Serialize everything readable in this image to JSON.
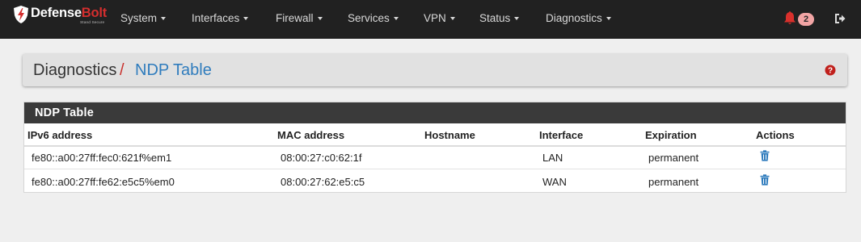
{
  "brand": {
    "name_part1": "Defense",
    "name_part2": "Bolt",
    "tagline": "Stand Secure"
  },
  "nav": {
    "items": [
      {
        "label": "System"
      },
      {
        "label": "Interfaces"
      },
      {
        "label": "Firewall"
      },
      {
        "label": "Services"
      },
      {
        "label": "VPN"
      },
      {
        "label": "Status"
      },
      {
        "label": "Diagnostics"
      }
    ],
    "notification_count": "2",
    "notification_icon": "bell-icon",
    "logout_icon": "sign-out-icon"
  },
  "breadcrumb": {
    "section": "Diagnostics",
    "separator": "/",
    "current": "NDP Table",
    "help_icon": "question-circle-icon"
  },
  "table": {
    "title": "NDP Table",
    "columns": [
      "IPv6 address",
      "MAC address",
      "Hostname",
      "Interface",
      "Expiration",
      "Actions"
    ],
    "rows": [
      {
        "ipv6": "fe80::a00:27ff:fec0:621f%em1",
        "mac": "08:00:27:c0:62:1f",
        "hostname": "",
        "interface": "LAN",
        "expiration": "permanent",
        "action_icon": "trash-icon"
      },
      {
        "ipv6": "fe80::a00:27ff:fe62:e5c5%em0",
        "mac": "08:00:27:62:e5:c5",
        "hostname": "",
        "interface": "WAN",
        "expiration": "permanent",
        "action_icon": "trash-icon"
      }
    ]
  },
  "colors": {
    "navbar": "#212121",
    "accent_red": "#c9302c",
    "link_blue": "#2f7cbd",
    "panel_heading": "#3a3a3a",
    "badge": "#f2a5a5"
  }
}
